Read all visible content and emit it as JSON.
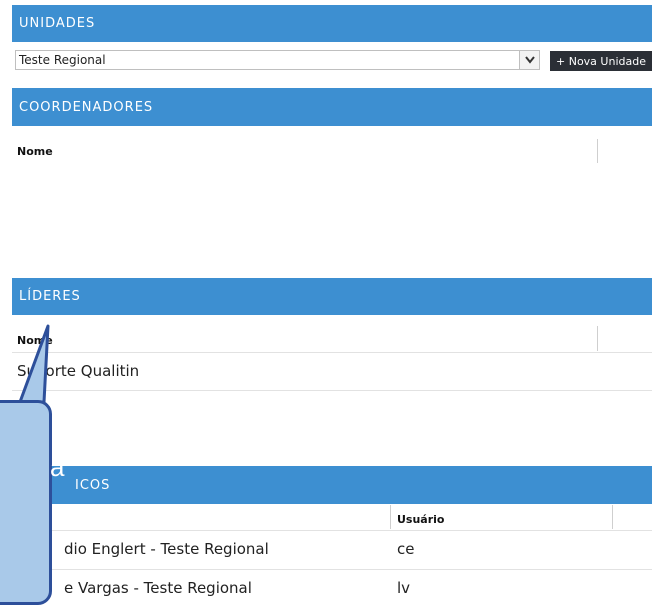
{
  "unidades": {
    "title": "UNIDADES",
    "selected": "Teste Regional",
    "new_button": "+ Nova Unidade"
  },
  "coordenadores": {
    "title": "COORDENADORES",
    "col_nome": "Nome"
  },
  "lideres": {
    "title": "LÍDERES",
    "col_nome": "Nome",
    "rows": [
      "Suporte Qualitin"
    ]
  },
  "tecnicos": {
    "title": "ICOS",
    "col_usuario": "Usuário",
    "rows": [
      {
        "nome": "dio Englert - Teste Regional",
        "usuario": "ce"
      },
      {
        "nome": "e Vargas - Teste Regional",
        "usuario": "lv"
      }
    ]
  },
  "callout": {
    "text": "a",
    "fill": "#a9c9e9",
    "border": "#2d4f9a"
  },
  "colors": {
    "header_bar": "#3d8fd1",
    "button_dark": "#2b2f36"
  }
}
